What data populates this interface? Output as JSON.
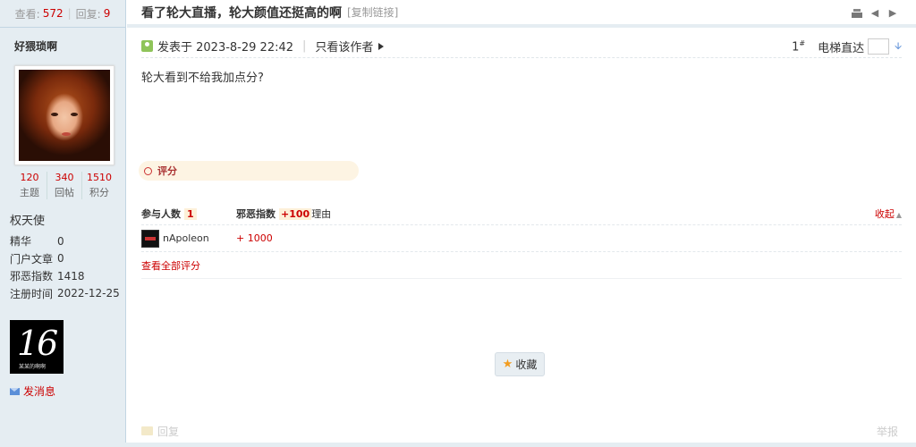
{
  "stats": {
    "views_label": "查看:",
    "views": "572",
    "replies_label": "回复:",
    "replies": "9"
  },
  "author": {
    "name": "好猥琐啊",
    "counts": [
      {
        "value": "120",
        "label": "主题"
      },
      {
        "value": "340",
        "label": "回帖"
      },
      {
        "value": "1510",
        "label": "积分"
      }
    ],
    "rank": "权天使",
    "info": [
      {
        "key": "精华",
        "value": "0"
      },
      {
        "key": "门户文章",
        "value": "0"
      },
      {
        "key": "邪恶指数",
        "value": "1418"
      },
      {
        "key": "注册时间",
        "value": "2022-12-25"
      }
    ],
    "medal": {
      "big": "16",
      "small": "某某的啊啊"
    },
    "send_message": "发消息"
  },
  "thread": {
    "title": "看了轮大直播，轮大颜值还挺高的啊",
    "copy_link": "[复制链接]"
  },
  "post": {
    "posted_at": "发表于 2023-8-29 22:42",
    "only_author": "只看该作者",
    "floor_num": "1",
    "floor_sup": "#",
    "jump_label": "电梯直达",
    "content": "轮大看到不给我加点分?"
  },
  "rating": {
    "label": "评分",
    "participants_label": "参与人数",
    "participants": "1",
    "index_label": "邪恶指数",
    "index_total": "+100",
    "reason_label": "理由",
    "collapse": "收起",
    "rows": [
      {
        "user": "nApoleon",
        "score": "+ 1000"
      }
    ],
    "view_all": "查看全部评分"
  },
  "actions": {
    "favorite": "收藏",
    "reply": "回复",
    "report": "举报"
  },
  "colors": {
    "accent_red": "#cc0000",
    "side_bg": "#e5edf2",
    "rate_bar": "#fdf4e3"
  }
}
